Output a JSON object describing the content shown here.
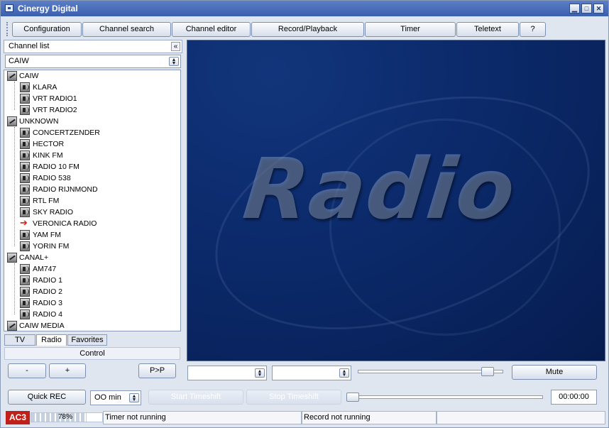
{
  "window": {
    "title": "Cinergy Digital"
  },
  "toolbar": {
    "buttons": [
      "Configuration",
      "Channel search",
      "Channel editor",
      "Record/Playback",
      "Timer",
      "Teletext",
      "?"
    ]
  },
  "channel_list": {
    "header": "Channel list",
    "collapse_glyph": "«",
    "selected_group": "CAIW",
    "groups": [
      {
        "name": "CAIW",
        "channels": [
          "KLARA",
          "VRT RADIO1",
          "VRT RADIO2"
        ]
      },
      {
        "name": "UNKNOWN",
        "channels": [
          "CONCERTZENDER",
          "HECTOR",
          "KINK FM",
          "RADIO 10 FM",
          "RADIO 538",
          "RADIO RIJNMOND",
          "RTL FM",
          "SKY RADIO",
          "VERONICA RADIO",
          "YAM FM",
          "YORIN FM"
        ]
      },
      {
        "name": "CANAL+",
        "channels": [
          "AM747",
          "RADIO 1",
          "RADIO 2",
          "RADIO 3",
          "RADIO 4"
        ]
      },
      {
        "name": "CAIW MEDIA",
        "channels": []
      }
    ],
    "playing_channel": "VERONICA RADIO",
    "tabs": [
      "TV",
      "Radio",
      "Favorites"
    ],
    "active_tab": "Radio"
  },
  "control": {
    "header": "Control",
    "minus_label": "-",
    "plus_label": "+",
    "pip_label": "P>P"
  },
  "video": {
    "overlay_text": "Radio",
    "volume_level": 0.93
  },
  "audio_controls": {
    "mute_label": "Mute"
  },
  "recording": {
    "quick_rec_label": "Quick REC",
    "duration_value": "OO min",
    "start_timeshift_label": "Start Timeshift",
    "stop_timeshift_label": "Stop Timeshift",
    "time": "00:00:00"
  },
  "status": {
    "audio_format": "AC3",
    "signal_percent": "78%",
    "signal_level": 0.78,
    "timer_status": "Timer not running",
    "record_status": "Record not running"
  },
  "colors": {
    "title_bar": "#3a5fae",
    "video_bg": "#0a2663",
    "ac3_badge": "#c0201a",
    "playing_arrow": "#d02010"
  }
}
